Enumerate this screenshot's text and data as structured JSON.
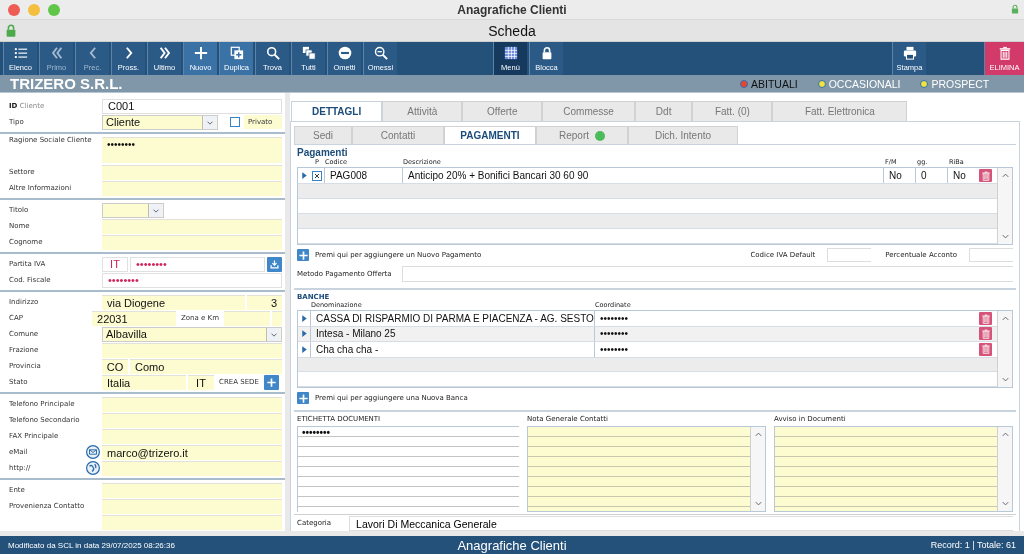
{
  "window": {
    "title": "Anagrafiche Clienti",
    "subtitle": "Scheda"
  },
  "toolbar": {
    "left": [
      {
        "label": "Elenco",
        "kind": "normal"
      },
      {
        "label": "Primo",
        "kind": "disabled"
      },
      {
        "label": "Prec.",
        "kind": "disabled"
      },
      {
        "label": "Pross.",
        "kind": "normal"
      },
      {
        "label": "Ultimo",
        "kind": "normal"
      },
      {
        "label": "Nuovo",
        "kind": "accent"
      },
      {
        "label": "Duplica",
        "kind": "accent"
      },
      {
        "label": "Trova",
        "kind": "normal"
      },
      {
        "label": "Tutti",
        "kind": "normal"
      },
      {
        "label": "Ometti",
        "kind": "normal"
      },
      {
        "label": "Omessi",
        "kind": "normal"
      }
    ],
    "center": [
      {
        "label": "Menù",
        "kind": "active"
      },
      {
        "label": "Blocca",
        "kind": "normal"
      }
    ],
    "right": [
      {
        "label": "Stampa",
        "kind": "normal"
      },
      {
        "label": "ELIMINA",
        "kind": "danger"
      }
    ]
  },
  "company": {
    "name": "TRIZERO S.R.L.",
    "categories": [
      {
        "label": "ABITUALI",
        "selected": true,
        "color": "#e8452c"
      },
      {
        "label": "OCCASIONALI",
        "selected": false,
        "color": "#f2e23a"
      },
      {
        "label": "PROSPECT",
        "selected": false,
        "color": "#f2e23a"
      }
    ]
  },
  "form": [
    {
      "rows": [
        {
          "label": "**ID** Cliente",
          "fields": [
            {
              "kind": "plain",
              "value": "C001"
            }
          ]
        },
        {
          "label": "Tipo",
          "fields": [
            {
              "kind": "select",
              "value": "Cliente"
            },
            {
              "kind": "checkbox",
              "label": "Privato",
              "checked": false
            }
          ]
        }
      ]
    },
    {
      "rows": [
        {
          "label": "Ragione Sociale Cliente",
          "fields": [
            {
              "kind": "multiline",
              "value": "••••••••"
            }
          ]
        },
        {
          "label": "Settore",
          "fields": [
            {
              "kind": "text"
            }
          ]
        },
        {
          "label": "Altre Informazioni",
          "fields": [
            {
              "kind": "text"
            }
          ]
        }
      ]
    },
    {
      "rows": [
        {
          "label": "Titolo",
          "fields": [
            {
              "kind": "select"
            }
          ]
        },
        {
          "label": "Nome",
          "fields": [
            {
              "kind": "text"
            }
          ]
        },
        {
          "label": "Cognome",
          "fields": [
            {
              "kind": "text"
            }
          ]
        }
      ]
    },
    {
      "rows": [
        {
          "label": "Partita IVA",
          "invalid": true,
          "fields": [
            {
              "kind": "prefix",
              "value": "IT"
            },
            {
              "kind": "plain",
              "value": "••••••••"
            },
            {
              "kind": "download-button"
            }
          ]
        },
        {
          "label": "Cod. Fiscale",
          "invalid": true,
          "fields": [
            {
              "kind": "plain",
              "value": "••••••••"
            }
          ]
        }
      ]
    },
    {
      "rows": [
        {
          "label": "Indirizzo",
          "fields": [
            {
              "kind": "text",
              "value": "via Diogene"
            },
            {
              "kind": "number",
              "value": "3"
            }
          ]
        },
        {
          "label": "CAP",
          "fields": [
            {
              "kind": "text",
              "value": "22031"
            },
            {
              "kind": "caption",
              "value": "Zona e Km"
            },
            {
              "kind": "short"
            },
            {
              "kind": "short"
            }
          ]
        },
        {
          "label": "Comune",
          "fields": [
            {
              "kind": "select",
              "value": "Albavilla"
            }
          ]
        },
        {
          "label": "Frazione",
          "fields": [
            {
              "kind": "text"
            }
          ]
        },
        {
          "label": "Provincia",
          "fields": [
            {
              "kind": "code",
              "value": "CO"
            },
            {
              "kind": "text",
              "value": "Como"
            }
          ]
        },
        {
          "label": "Stato",
          "fields": [
            {
              "kind": "text",
              "value": "Italia"
            },
            {
              "kind": "code",
              "value": "IT"
            },
            {
              "kind": "caption",
              "value": "CREA SEDE"
            },
            {
              "kind": "add-button"
            }
          ]
        }
      ]
    },
    {
      "rows": [
        {
          "label": "Telefono Principale",
          "fields": [
            {
              "kind": "text"
            }
          ]
        },
        {
          "label": "Telefono Secondario",
          "fields": [
            {
              "kind": "text"
            }
          ]
        },
        {
          "label": "FAX Principale",
          "fields": [
            {
              "kind": "text"
            }
          ]
        },
        {
          "label": "eMail",
          "fields": [
            {
              "kind": "mail-button"
            },
            {
              "kind": "text",
              "value": "marco@trizero.it"
            }
          ]
        },
        {
          "label": "http://",
          "fields": [
            {
              "kind": "web-button"
            },
            {
              "kind": "text"
            }
          ]
        }
      ]
    },
    {
      "rows": [
        {
          "label": "Ente",
          "fields": [
            {
              "kind": "text"
            }
          ]
        },
        {
          "label": "Provenienza Contatto",
          "fields": [
            {
              "kind": "text"
            }
          ]
        },
        {
          "fields": [
            {
              "kind": "text"
            }
          ]
        }
      ]
    }
  ],
  "tabs": [
    {
      "label": "DETTAGLI",
      "selected": true
    },
    {
      "label": "Attività",
      "selected": false
    },
    {
      "label": "Offerte",
      "selected": false
    },
    {
      "label": "Commesse",
      "selected": false
    },
    {
      "label": "Ddt",
      "selected": false
    },
    {
      "label": "Fatt. (0)",
      "selected": false
    },
    {
      "label": "Fatt. Elettronica",
      "selected": false
    }
  ],
  "subtabs": [
    {
      "label": "Sedi",
      "selected": false,
      "dot": false
    },
    {
      "label": "Contatti",
      "selected": false,
      "dot": false
    },
    {
      "label": "PAGAMENTI",
      "selected": true,
      "dot": false
    },
    {
      "label": "Report",
      "selected": false,
      "dot": true
    },
    {
      "label": "Dich. Intento",
      "selected": false,
      "dot": false
    }
  ],
  "pagamenti": {
    "title": "Pagamenti",
    "columns": [
      "P",
      "Codice",
      "Descrizione",
      "F/M",
      "gg.",
      "RiBa"
    ],
    "rows": [
      {
        "checked": true,
        "codice": "PAG008",
        "descrizione": "Anticipo 20% + Bonifici Bancari 30 60 90",
        "fm": "No",
        "gg": "0",
        "riba": "No"
      }
    ],
    "add_label": "Premi qui per aggiungere un Nuovo Pagamento",
    "options": [
      {
        "label": "Codice IVA Default"
      },
      {
        "label": "Percentuale Acconto"
      }
    ],
    "method_label": "Metodo Pagamento Offerta"
  },
  "banche": {
    "title": "BANCHE",
    "columns": [
      "Denominazione",
      "Coordinate"
    ],
    "rows": [
      {
        "name": "CASSA DI RISPARMIO DI PARMA E PIACENZA - AG. SESTO",
        "coord": "••••••••"
      },
      {
        "name": "Intesa - Milano 25",
        "coord": "••••••••"
      },
      {
        "name": "Cha cha cha -",
        "coord": "••••••••"
      }
    ],
    "add_label": "Premi qui per aggiungere una Nuova Banca"
  },
  "notes": [
    {
      "label": "ETICHETTA DOCUMENTI",
      "kind": "plain",
      "value": "••••••••"
    },
    {
      "label": "Nota Generale Contatti",
      "kind": "memo"
    },
    {
      "label": "Avviso in Documenti",
      "kind": "memo"
    }
  ],
  "categoria": {
    "label": "Categoria",
    "value": "Lavori Di Meccanica Generale"
  },
  "status_bar": {
    "left": "Modificato da SCL in data 29/07/2025 08:26:36",
    "center": "Anagrafiche Clienti",
    "right": "Record: 1 | Totale: 61"
  }
}
